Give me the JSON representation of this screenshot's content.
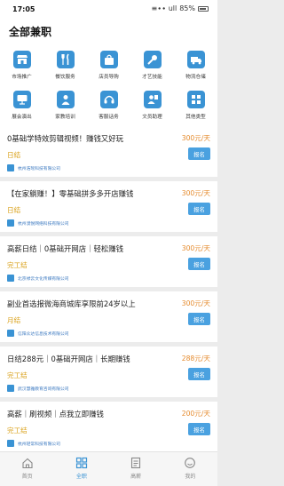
{
  "status_bar": {
    "time": "17:05",
    "signal_icons": "≡∙∙ ull",
    "battery": "85%"
  },
  "header": {
    "title": "全部兼职"
  },
  "categories": [
    {
      "label": "市场推广",
      "icon": "store-icon"
    },
    {
      "label": "餐饮服务",
      "icon": "utensils-icon"
    },
    {
      "label": "店员导购",
      "icon": "shopping-bag-icon"
    },
    {
      "label": "才艺技能",
      "icon": "microphone-icon"
    },
    {
      "label": "物流仓储",
      "icon": "truck-icon"
    },
    {
      "label": "展会演出",
      "icon": "screen-icon"
    },
    {
      "label": "家教培训",
      "icon": "person-icon"
    },
    {
      "label": "客服话务",
      "icon": "headset-icon"
    },
    {
      "label": "文员助理",
      "icon": "assistant-icon"
    },
    {
      "label": "其他类型",
      "icon": "grid-icon"
    }
  ],
  "jobs": [
    {
      "title": "0基础学特效剪辑视频！赚钱又好玩",
      "salary": "300元/天",
      "settle": "日结",
      "apply": "报名",
      "company": "杭州浩瑶科技有限公司"
    },
    {
      "title": "【在家躺赚！】零基础拼多多开店赚钱",
      "salary": "300元/天",
      "settle": "日结",
      "apply": "报名",
      "company": "杭州漠悦网络科技有限公司"
    },
    {
      "title": "高薪日结｜0基础开网店｜轻松赚钱",
      "salary": "300元/天",
      "settle": "完工结",
      "apply": "报名",
      "company": "北京禄云文化传媒有限公司"
    },
    {
      "title": "副业首选报微海商城库享限前24岁以上",
      "salary": "300元/天",
      "settle": "月结",
      "apply": "报名",
      "company": "信阳众达信息技术有限公司"
    },
    {
      "title": "日结288元｜0基础开网店｜长期赚钱",
      "salary": "288元/天",
      "settle": "完工结",
      "apply": "报名",
      "company": "武汉慧雅教育咨询有限公司"
    },
    {
      "title": "高薪｜刷视频｜点我立即赚钱",
      "salary": "200元/天",
      "settle": "完工结",
      "apply": "报名",
      "company": "杭州轻常科技有限公司"
    }
  ],
  "tabs": [
    {
      "label": "首页",
      "icon": "home-icon",
      "active": false
    },
    {
      "label": "全职",
      "icon": "grid-icon",
      "active": true
    },
    {
      "label": "高薪",
      "icon": "document-icon",
      "active": false
    },
    {
      "label": "我的",
      "icon": "smile-icon",
      "active": false
    }
  ],
  "colors": {
    "accent": "#3a93d4",
    "salary": "#e58b2e",
    "settle": "#d9a018",
    "apply_button": "#4aa1e0"
  }
}
